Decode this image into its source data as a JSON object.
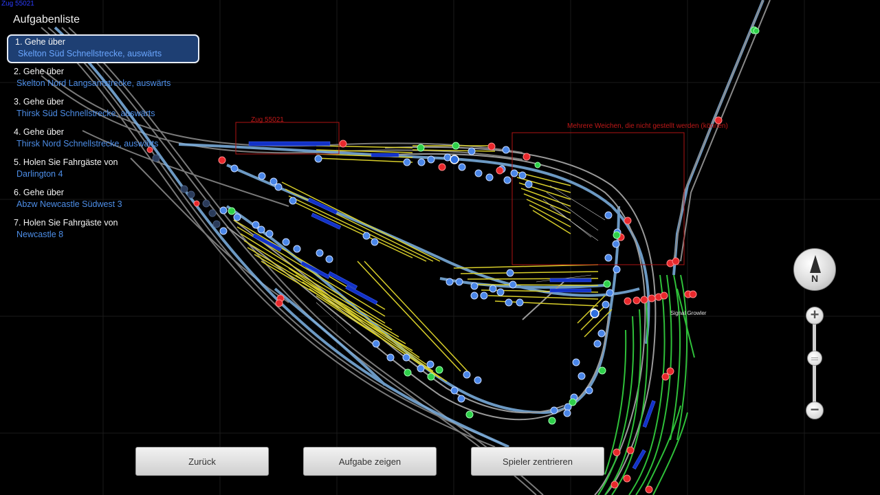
{
  "corner_id": "Zug 55021",
  "task_list": {
    "title": "Aufgabenliste",
    "items": [
      {
        "line1": "1. Gehe über",
        "line2": "Skelton Süd Schnellstrecke, auswärts",
        "active": true
      },
      {
        "line1": "2. Gehe über",
        "line2": "Skelton Nord Langsamstrecke, auswärts",
        "active": false
      },
      {
        "line1": "3. Gehe über",
        "line2": "Thirsk Süd Schnellstrecke, auswärts",
        "active": false
      },
      {
        "line1": "4. Gehe über",
        "line2": "Thirsk Nord Schnellstrecke, auswärts",
        "active": false
      },
      {
        "line1": "5. Holen Sie Fahrgäste von",
        "line2": "Darlington 4",
        "active": false
      },
      {
        "line1": "6. Gehe über",
        "line2": "Abzw Newcastle Südwest 3",
        "active": false
      },
      {
        "line1": "7. Holen Sie Fahrgäste von",
        "line2": "Newcastle 8",
        "active": false
      }
    ]
  },
  "map_labels": {
    "train": "Zug 55021",
    "switch_warning": "Mehrere Weichen, die nicht gestellt werden (können)",
    "signal_box": "Signal Growler"
  },
  "buttons": {
    "back": "Zurück",
    "show_task": "Aufgabe zeigen",
    "center_player": "Spieler zentrieren"
  },
  "compass": {
    "label": "N"
  },
  "zoom": {
    "plus": "+",
    "minus": "−"
  },
  "colors": {
    "background": "#000000",
    "track_rail": "#8a8a8a",
    "track_light_blue": "#7fb4e6",
    "siding_yellow": "#d9cf2a",
    "siding_green": "#2fc13a",
    "node_blue": "#4a86e8",
    "signal_red": "#e8282c",
    "signal_green": "#2fd04a",
    "warning_red": "#c01818",
    "train_blue": "#1232c8",
    "panel_active": "#1e3f73",
    "task_link": "#4d8ee8"
  }
}
